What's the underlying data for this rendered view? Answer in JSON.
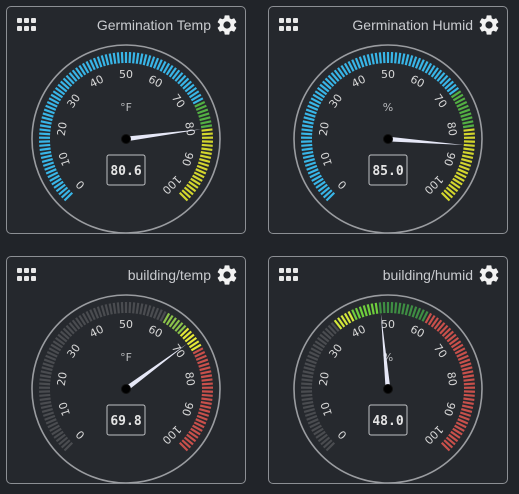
{
  "widgets": [
    {
      "title": "Germination Temp",
      "unit": "°F",
      "value": 80.6,
      "display": "80.6",
      "scale": {
        "min": 0,
        "max": 100,
        "major_ticks": [
          "0",
          "10",
          "20",
          "30",
          "40",
          "50",
          "60",
          "70",
          "80",
          "90",
          "100"
        ]
      },
      "bands": [
        {
          "from": 0,
          "to": 73,
          "color": "#38b6e8"
        },
        {
          "from": 73,
          "to": 80,
          "color": "#53b043"
        },
        {
          "from": 80,
          "to": 100,
          "color": "#d3d62d"
        }
      ]
    },
    {
      "title": "Germination Humid",
      "unit": "%",
      "value": 85.0,
      "display": "85.0",
      "scale": {
        "min": 0,
        "max": 100,
        "major_ticks": [
          "0",
          "10",
          "20",
          "30",
          "40",
          "50",
          "60",
          "70",
          "80",
          "90",
          "100"
        ]
      },
      "bands": [
        {
          "from": 0,
          "to": 70,
          "color": "#38b6e8"
        },
        {
          "from": 70,
          "to": 80,
          "color": "#53b043"
        },
        {
          "from": 80,
          "to": 100,
          "color": "#d3d62d"
        }
      ]
    },
    {
      "title": "building/temp",
      "unit": "°F",
      "value": 69.8,
      "display": "69.8",
      "scale": {
        "min": 0,
        "max": 100,
        "major_ticks": [
          "0",
          "10",
          "20",
          "30",
          "40",
          "50",
          "60",
          "70",
          "80",
          "90",
          "100"
        ]
      },
      "bands": [
        {
          "from": 0,
          "to": 60,
          "color": "#4a4c50"
        },
        {
          "from": 60,
          "to": 66,
          "color": "#8bc34a"
        },
        {
          "from": 66,
          "to": 72,
          "color": "#e5e836"
        },
        {
          "from": 72,
          "to": 100,
          "color": "#c9504b"
        }
      ]
    },
    {
      "title": "building/humid",
      "unit": "%",
      "value": 48.0,
      "display": "48.0",
      "scale": {
        "min": 0,
        "max": 100,
        "major_ticks": [
          "0",
          "10",
          "20",
          "30",
          "40",
          "50",
          "60",
          "70",
          "80",
          "90",
          "100"
        ]
      },
      "bands": [
        {
          "from": 0,
          "to": 35,
          "color": "#4a4c50"
        },
        {
          "from": 35,
          "to": 40,
          "color": "#d4e83a"
        },
        {
          "from": 40,
          "to": 47,
          "color": "#6fce3d"
        },
        {
          "from": 47,
          "to": 60,
          "color": "#3e8e43"
        },
        {
          "from": 60,
          "to": 100,
          "color": "#c9504b"
        }
      ]
    }
  ],
  "colors": {
    "card_bg": "#25282d",
    "card_border": "#8c8f94",
    "title_text": "#c9cbcf",
    "tick_label": "#d8d8d8",
    "needle": "#e6e8f7",
    "icon": "#e8e8e8"
  }
}
